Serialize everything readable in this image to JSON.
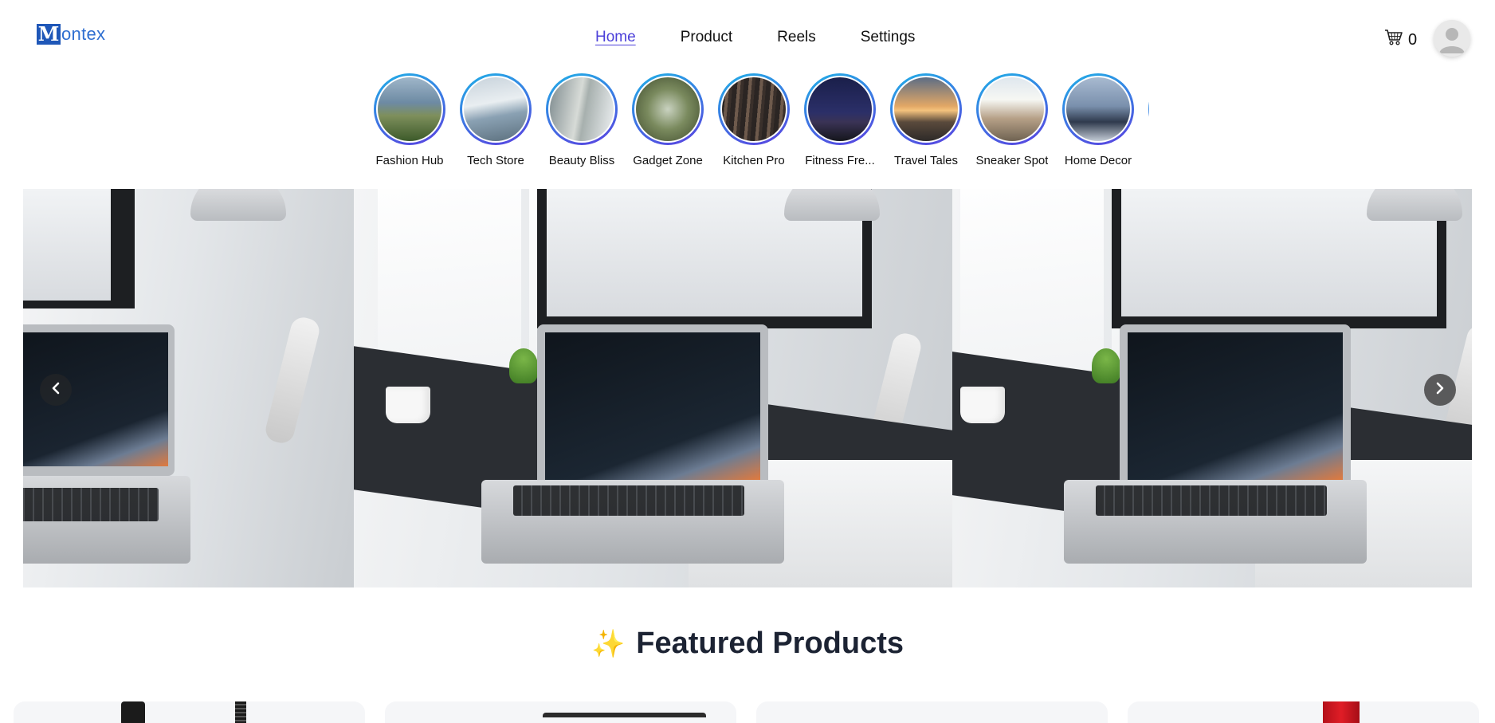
{
  "header": {
    "logo_mark": "M",
    "logo_text": "ontex",
    "nav": [
      {
        "label": "Home",
        "active": true
      },
      {
        "label": "Product",
        "active": false
      },
      {
        "label": "Reels",
        "active": false
      },
      {
        "label": "Settings",
        "active": false
      }
    ],
    "cart_count": "0",
    "cart_icon": "cart-icon",
    "avatar_icon": "user-avatar-icon"
  },
  "stories": [
    {
      "label": "Fashion Hub"
    },
    {
      "label": "Tech Store"
    },
    {
      "label": "Beauty Bliss"
    },
    {
      "label": "Gadget Zone"
    },
    {
      "label": "Kitchen Pro"
    },
    {
      "label": "Fitness Fre..."
    },
    {
      "label": "Travel Tales"
    },
    {
      "label": "Sneaker Spot"
    },
    {
      "label": "Home Decor"
    }
  ],
  "banner": {
    "prev_icon": "chevron-left-icon",
    "next_icon": "chevron-right-icon"
  },
  "featured": {
    "icon": "sparkles-icon",
    "emoji": "✨",
    "title": "Featured Products"
  },
  "colors": {
    "accent": "#4b3fd9",
    "logo_blue": "#1f57b8",
    "story_ring_start": "#1fb0e6",
    "story_ring_end": "#5a3fe0",
    "heading": "#1c2333"
  }
}
